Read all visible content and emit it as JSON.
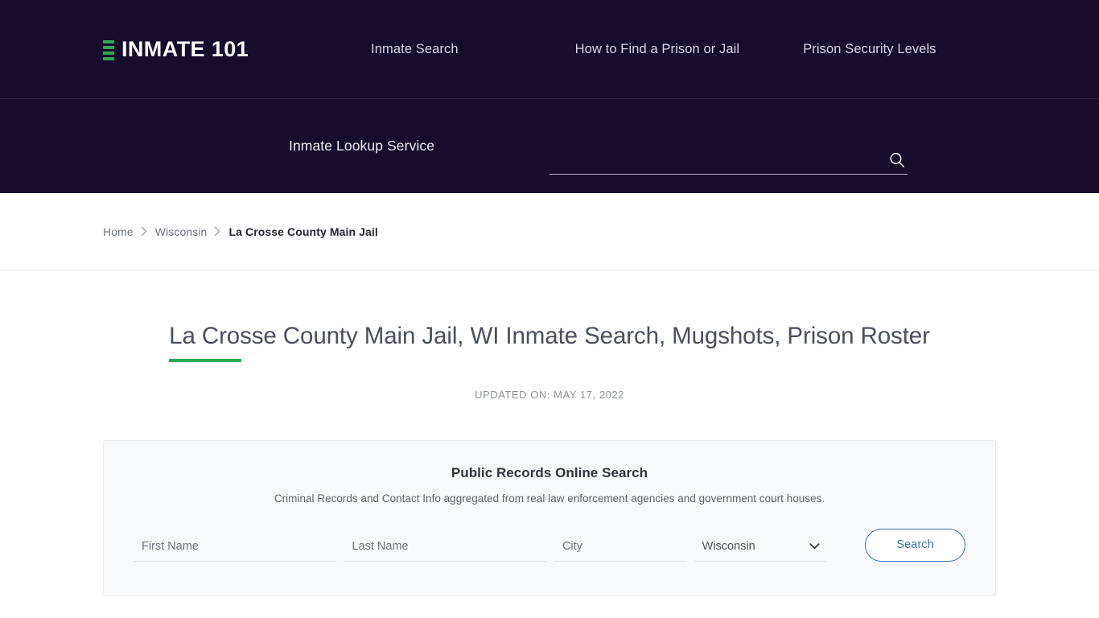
{
  "header": {
    "brand": {
      "text": "INMATE 101",
      "mark_color": "#2fa84f",
      "bars": 4
    },
    "nav": [
      {
        "label": "Inmate Search"
      },
      {
        "label": "How to Find a Prison or Jail"
      },
      {
        "label": "Prison Security Levels"
      }
    ],
    "background": "#150d2b"
  },
  "search_strip": {
    "label": "Inmate Lookup Service",
    "input_value": "",
    "input_placeholder": "",
    "icon": "search-icon"
  },
  "breadcrumb": {
    "items": [
      {
        "label": "Home",
        "current": false
      },
      {
        "label": "Wisconsin",
        "current": false
      },
      {
        "label": "La Crosse County Main Jail",
        "current": true
      }
    ],
    "separator": "›"
  },
  "main": {
    "title": "La Crosse County Main Jail, WI Inmate Search, Mugshots, Prison Roster",
    "accent_color": "#2fa84f",
    "updated": "UPDATED ON: MAY 17, 2022"
  },
  "records_card": {
    "title": "Public Records Online Search",
    "subtitle": "Criminal Records and Contact Info aggregated from real law enforcement agencies and government court houses.",
    "fields": {
      "first_name": {
        "placeholder": "First Name",
        "value": ""
      },
      "last_name": {
        "placeholder": "Last Name",
        "value": ""
      },
      "city": {
        "placeholder": "City",
        "value": ""
      },
      "state": {
        "selected": "Wisconsin",
        "options": [
          "Wisconsin"
        ]
      }
    },
    "submit_label": "Search",
    "submit_color": "#4470ae"
  }
}
